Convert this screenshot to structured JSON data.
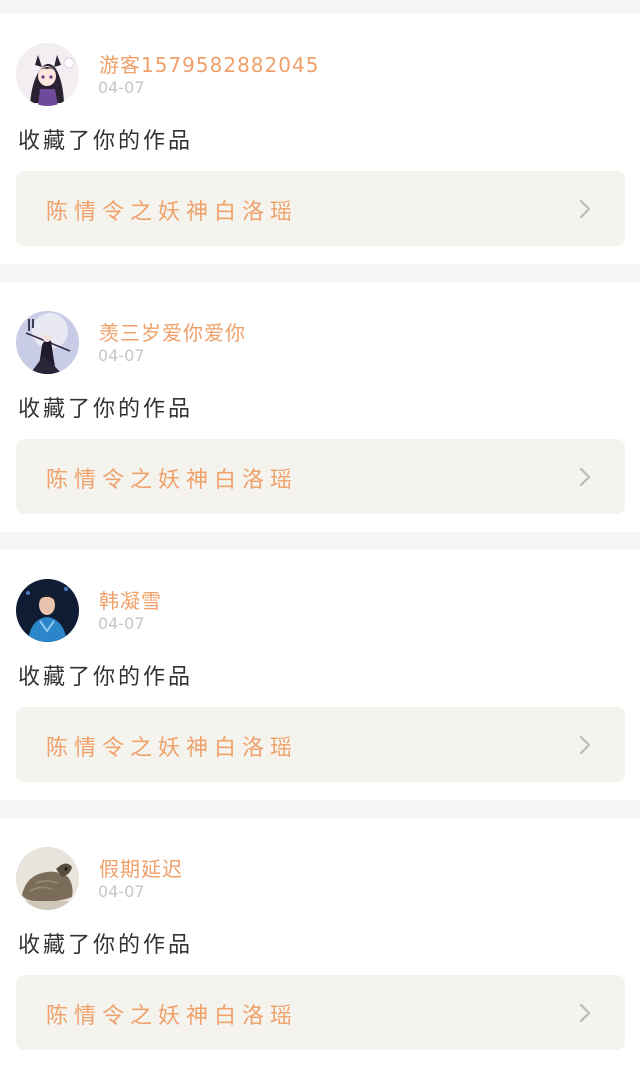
{
  "notifications": [
    {
      "username": "游客1579582882045",
      "date": "04-07",
      "action": "收藏了你的作品",
      "work_title": "陈情令之妖神白洛瑶",
      "avatar_icon": "anime-girl-avatar-icon"
    },
    {
      "username": "羡三岁爱你爱你",
      "date": "04-07",
      "action": "收藏了你的作品",
      "work_title": "陈情令之妖神白洛瑶",
      "avatar_icon": "swordsman-avatar-icon"
    },
    {
      "username": "韩凝雪",
      "date": "04-07",
      "action": "收藏了你的作品",
      "work_title": "陈情令之妖神白洛瑶",
      "avatar_icon": "young-man-avatar-icon"
    },
    {
      "username": "假期延迟",
      "date": "04-07",
      "action": "收藏了你的作品",
      "work_title": "陈情令之妖神白洛瑶",
      "avatar_icon": "animal-avatar-icon"
    }
  ],
  "colors": {
    "accent": "#f0a06a",
    "date": "#c6c6c6",
    "box_bg": "#f4f3ee",
    "separator": "#f7f5f5"
  }
}
